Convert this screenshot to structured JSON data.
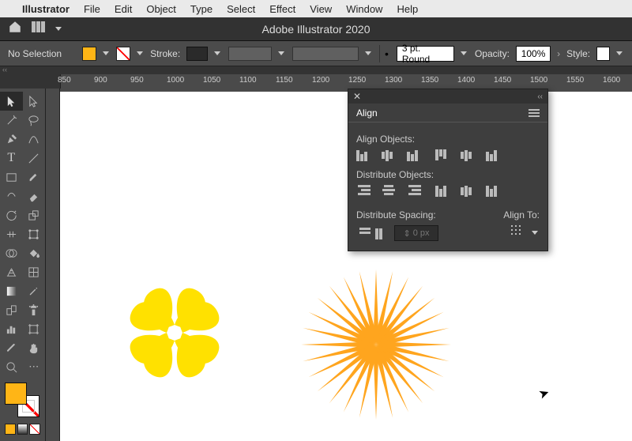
{
  "mac_menu": {
    "app": "Illustrator",
    "items": [
      "File",
      "Edit",
      "Object",
      "Type",
      "Select",
      "Effect",
      "View",
      "Window",
      "Help"
    ]
  },
  "app": {
    "title": "Adobe Illustrator 2020"
  },
  "control": {
    "selection": "No Selection",
    "stroke_label": "Stroke:",
    "stroke_weight": "",
    "round_style": "3 pt. Round",
    "opacity_label": "Opacity:",
    "opacity_value": "100%",
    "style_label": "Style:"
  },
  "ruler": {
    "marks": [
      "850",
      "900",
      "950",
      "1000",
      "1050",
      "1100",
      "1150",
      "1200",
      "1250",
      "1300",
      "1350",
      "1400",
      "1450",
      "1500",
      "1550",
      "1600"
    ]
  },
  "panel": {
    "title": "Align",
    "sections": {
      "align": "Align Objects:",
      "distribute": "Distribute Objects:",
      "spacing": "Distribute Spacing:",
      "align_to": "Align To:",
      "spacing_value": "0 px"
    }
  },
  "colors": {
    "fill": "#ffb516",
    "hearts": "#ffe100",
    "star": "#ffa51e"
  }
}
